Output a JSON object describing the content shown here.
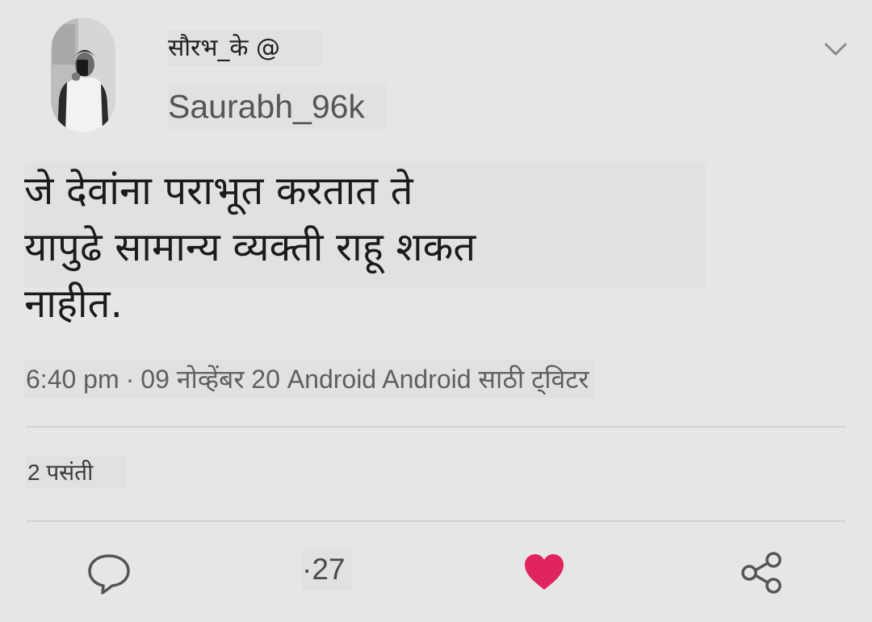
{
  "user": {
    "display_name": "सौरभ_के @",
    "handle": "Saurabh_96k"
  },
  "tweet": {
    "text_lines": [
      "जे देवांना पराभूत करतात ते",
      "यापुढे सामान्य व्यक्ती राहू शकत",
      "नाहीत."
    ],
    "time": "6:40 pm",
    "date": "09 नोव्हेंबर 20",
    "source": "Android Android साठी ट्विटर"
  },
  "stats": {
    "likes_label": "2 पसंती"
  },
  "actions": {
    "retweet_count": "·27"
  },
  "icons": {
    "menu": "chevron-down-icon",
    "reply": "reply-icon",
    "like": "heart-icon",
    "share": "share-icon"
  },
  "colors": {
    "background": "#e6e6e6",
    "like_active": "#e0245e",
    "icon": "#555555"
  }
}
